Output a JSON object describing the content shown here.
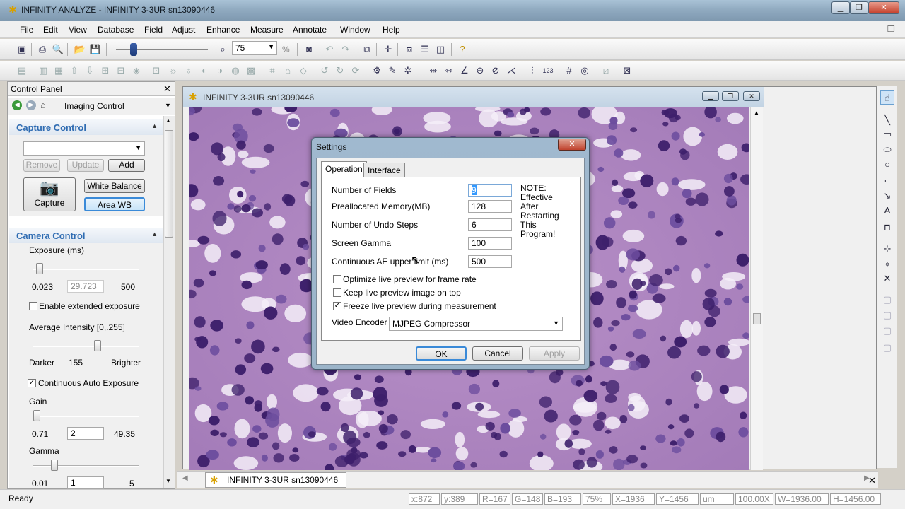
{
  "window": {
    "title": "INFINITY ANALYZE - INFINITY 3-3UR sn13090446"
  },
  "menu": [
    "File",
    "Edit",
    "View",
    "Database",
    "Field",
    "Adjust",
    "Enhance",
    "Measure",
    "Annotate",
    "Window",
    "Help"
  ],
  "toolbar": {
    "zoom_value": "75",
    "zoom_unit": "%"
  },
  "control_panel": {
    "title": "Control Panel",
    "nav_label": "Imaging Control",
    "capture": {
      "header": "Capture Control",
      "dropdown_value": "",
      "remove_label": "Remove",
      "update_label": "Update",
      "add_label": "Add",
      "capture_label": "Capture",
      "white_balance_label": "White Balance",
      "area_wb_label": "Area WB"
    },
    "camera": {
      "header": "Camera Control",
      "exposure_label": "Exposure (ms)",
      "exposure_min": "0.023",
      "exposure_value": "29.723",
      "exposure_max": "500",
      "exposure_fraction": 0.059,
      "extended_label": "Enable extended exposure",
      "extended_checked": false,
      "avg_label": "Average Intensity [0,.255]",
      "avg_darker": "Darker",
      "avg_value": "155",
      "avg_brighter": "Brighter",
      "avg_fraction": 0.608,
      "auto_label": "Continuous Auto Exposure",
      "auto_checked": true,
      "gain_label": "Gain",
      "gain_min": "0.71",
      "gain_value": "2",
      "gain_max": "49.35",
      "gain_fraction": 0.03,
      "gamma_label": "Gamma",
      "gamma_min": "0.01",
      "gamma_value": "1",
      "gamma_max": "5",
      "gamma_fraction": 0.2
    }
  },
  "child_window": {
    "title": "INFINITY 3-3UR sn13090446"
  },
  "settings_dialog": {
    "title": "Settings",
    "tabs": [
      "Operation",
      "Interface"
    ],
    "fields": [
      {
        "label": "Number of Fields",
        "value": "9"
      },
      {
        "label": "Preallocated Memory(MB)",
        "value": "128"
      },
      {
        "label": "Number of Undo Steps",
        "value": "6"
      },
      {
        "label": "Screen Gamma",
        "value": "100"
      },
      {
        "label": "Continuous AE upper limit (ms)",
        "value": "500"
      }
    ],
    "note": "NOTE: Effective After Restarting This Program!",
    "checkboxes": [
      {
        "label": "Optimize live preview for frame rate",
        "checked": false
      },
      {
        "label": "Keep live preview image on top",
        "checked": false
      },
      {
        "label": "Freeze live preview during measurement",
        "checked": true
      }
    ],
    "video_encoder_label": "Video Encoder",
    "video_encoder_value": "MJPEG Compressor",
    "ok_label": "OK",
    "cancel_label": "Cancel",
    "apply_label": "Apply"
  },
  "mdi_tab": {
    "label": "INFINITY 3-3UR sn13090446"
  },
  "status": {
    "ready": "Ready",
    "cells": [
      "x:872",
      "y:389",
      "R=167",
      "G=148",
      "B=193",
      "75%",
      "X=1936",
      "Y=1456",
      "um",
      "100.00X",
      "W=1936.00",
      "H=1456.00"
    ]
  }
}
